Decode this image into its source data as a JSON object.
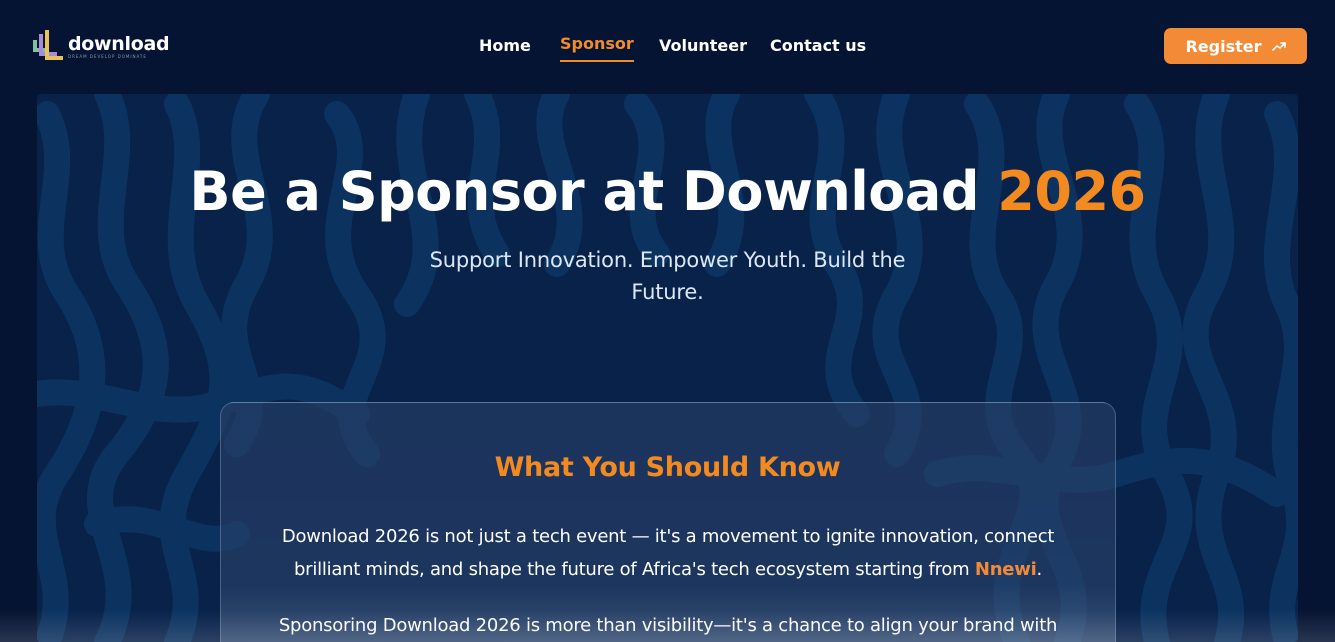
{
  "colors": {
    "background": "#061433",
    "pattern": "#0b2b55",
    "accent": "#f38a1f",
    "button": "#f38a35"
  },
  "logo": {
    "text": "download",
    "tagline": "DREAM DEVELOP DOMINATE"
  },
  "nav": {
    "items": [
      {
        "label": "Home",
        "active": false
      },
      {
        "label": "Sponsor",
        "active": true
      },
      {
        "label": "Volunteer",
        "active": false
      },
      {
        "label": "Contact us",
        "active": false
      }
    ],
    "register_label": "Register",
    "register_icon": "trending-up-icon"
  },
  "hero": {
    "title_main": "Be a Sponsor at Download ",
    "title_year": "2026",
    "subtitle": "Support Innovation. Empower Youth. Build the Future."
  },
  "card": {
    "title": "What You Should Know",
    "paragraph1_before": "Download 2026 is not just a tech event — it's a movement to ignite innovation, connect brilliant minds, and shape the future of Africa's tech ecosystem starting from ",
    "paragraph1_highlight": "Nnewi",
    "paragraph1_after": ".",
    "paragraph2": "Sponsoring Download 2026 is more than visibility—it's a chance to align your brand with"
  }
}
